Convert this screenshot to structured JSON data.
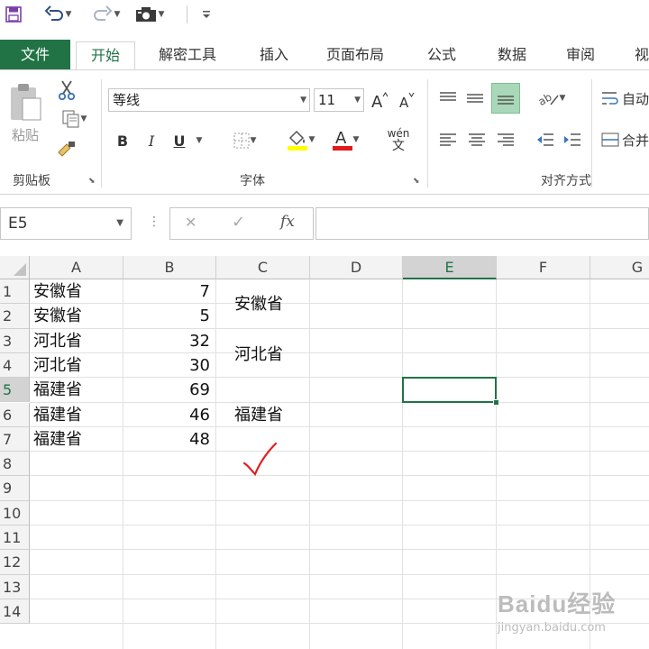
{
  "qat": {
    "save_icon": "save-icon",
    "undo_icon": "undo-icon",
    "redo_icon": "redo-icon",
    "camera_icon": "camera-icon",
    "customize_icon": "customize-icon"
  },
  "tabs": {
    "file": "文件",
    "home": "开始",
    "decrypt": "解密工具",
    "insert": "插入",
    "layout": "页面布局",
    "formula": "公式",
    "data": "数据",
    "review": "审阅",
    "view": "视"
  },
  "ribbon": {
    "clipboard": {
      "paste": "粘贴",
      "label": "剪贴板"
    },
    "font": {
      "font_name": "等线",
      "font_size": "11",
      "bold": "B",
      "italic": "I",
      "underline": "U",
      "font_color_glyph": "A",
      "phonetic_top": "wén",
      "phonetic_bottom": "文",
      "label": "字体"
    },
    "alignment": {
      "wrap": "自动",
      "merge": "合并",
      "label": "对齐方式"
    }
  },
  "formula_bar": {
    "name_box": "E5",
    "cancel": "✕",
    "confirm": "✓",
    "fx": "fx",
    "content": ""
  },
  "grid": {
    "columns": [
      "A",
      "B",
      "C",
      "D",
      "E",
      "F",
      "G"
    ],
    "rows": [
      "1",
      "2",
      "3",
      "4",
      "5",
      "6",
      "7",
      "8",
      "9",
      "10",
      "11",
      "12",
      "13",
      "14"
    ],
    "selected_cell": "E5",
    "colA": [
      "安徽省",
      "安徽省",
      "河北省",
      "河北省",
      "福建省",
      "福建省",
      "福建省"
    ],
    "colB": [
      "7",
      "5",
      "32",
      "30",
      "69",
      "46",
      "48"
    ],
    "colC": [
      "安徽省",
      "河北省",
      "福建省"
    ]
  },
  "annotation": {
    "checkmark_color": "#e02020"
  },
  "watermark": {
    "text": "Baidu经验",
    "sub": "jingyan.baidu.com"
  },
  "colors": {
    "accent": "#217346"
  }
}
